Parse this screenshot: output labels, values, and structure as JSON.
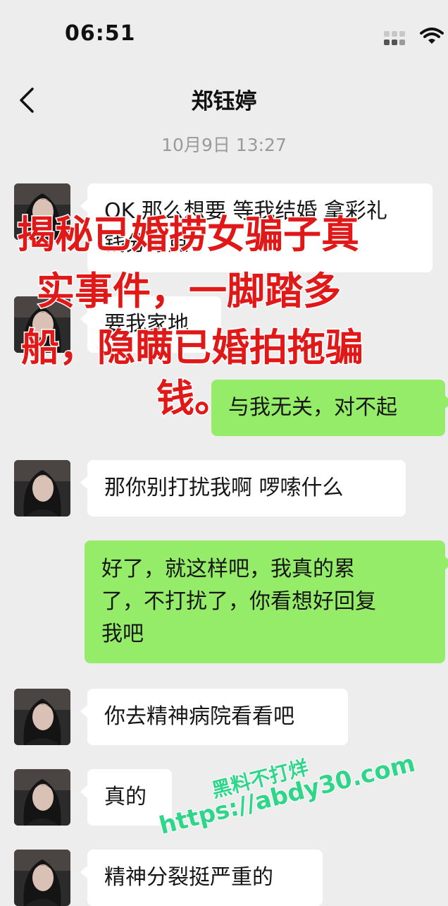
{
  "status_bar": {
    "time": "06:51",
    "signal_icon": "signal-bars-icon",
    "wifi_icon": "wifi-icon"
  },
  "nav": {
    "back_icon": "chevron-left-icon",
    "title": "郑钰婷"
  },
  "timestamp": "10月9日 13:27",
  "messages": [
    {
      "side": "in",
      "lines": [
        "OK 那么想要 等我结婚 拿彩礼",
        "钱分你点"
      ]
    },
    {
      "side": "in",
      "lines": [
        "要我家地"
      ]
    },
    {
      "side": "out",
      "lines": [
        "与我无关，对不起"
      ]
    },
    {
      "side": "in",
      "lines": [
        "那你别打扰我啊 啰嗦什么"
      ]
    },
    {
      "side": "out",
      "lines": [
        "好了，就这样吧，我真的累",
        "了，不打扰了，你看想好回复",
        "我吧"
      ]
    },
    {
      "side": "in",
      "lines": [
        "你去精神病院看看吧"
      ]
    },
    {
      "side": "in",
      "lines": [
        "真的"
      ]
    },
    {
      "side": "in",
      "lines": [
        "精神分裂挺严重的"
      ]
    }
  ],
  "overlay_caption": [
    "揭秘已婚捞女骗子真",
    "实事件，一脚踏多",
    "船，隐瞒已婚拍拖骗",
    "钱。"
  ],
  "watermark": [
    "黑料不打烊",
    "https://abdy30.com"
  ],
  "colors": {
    "background": "#ededed",
    "incoming_bubble": "#ffffff",
    "outgoing_bubble": "#95ec69",
    "caption": "#e01818",
    "watermark": "#2fd68a"
  }
}
